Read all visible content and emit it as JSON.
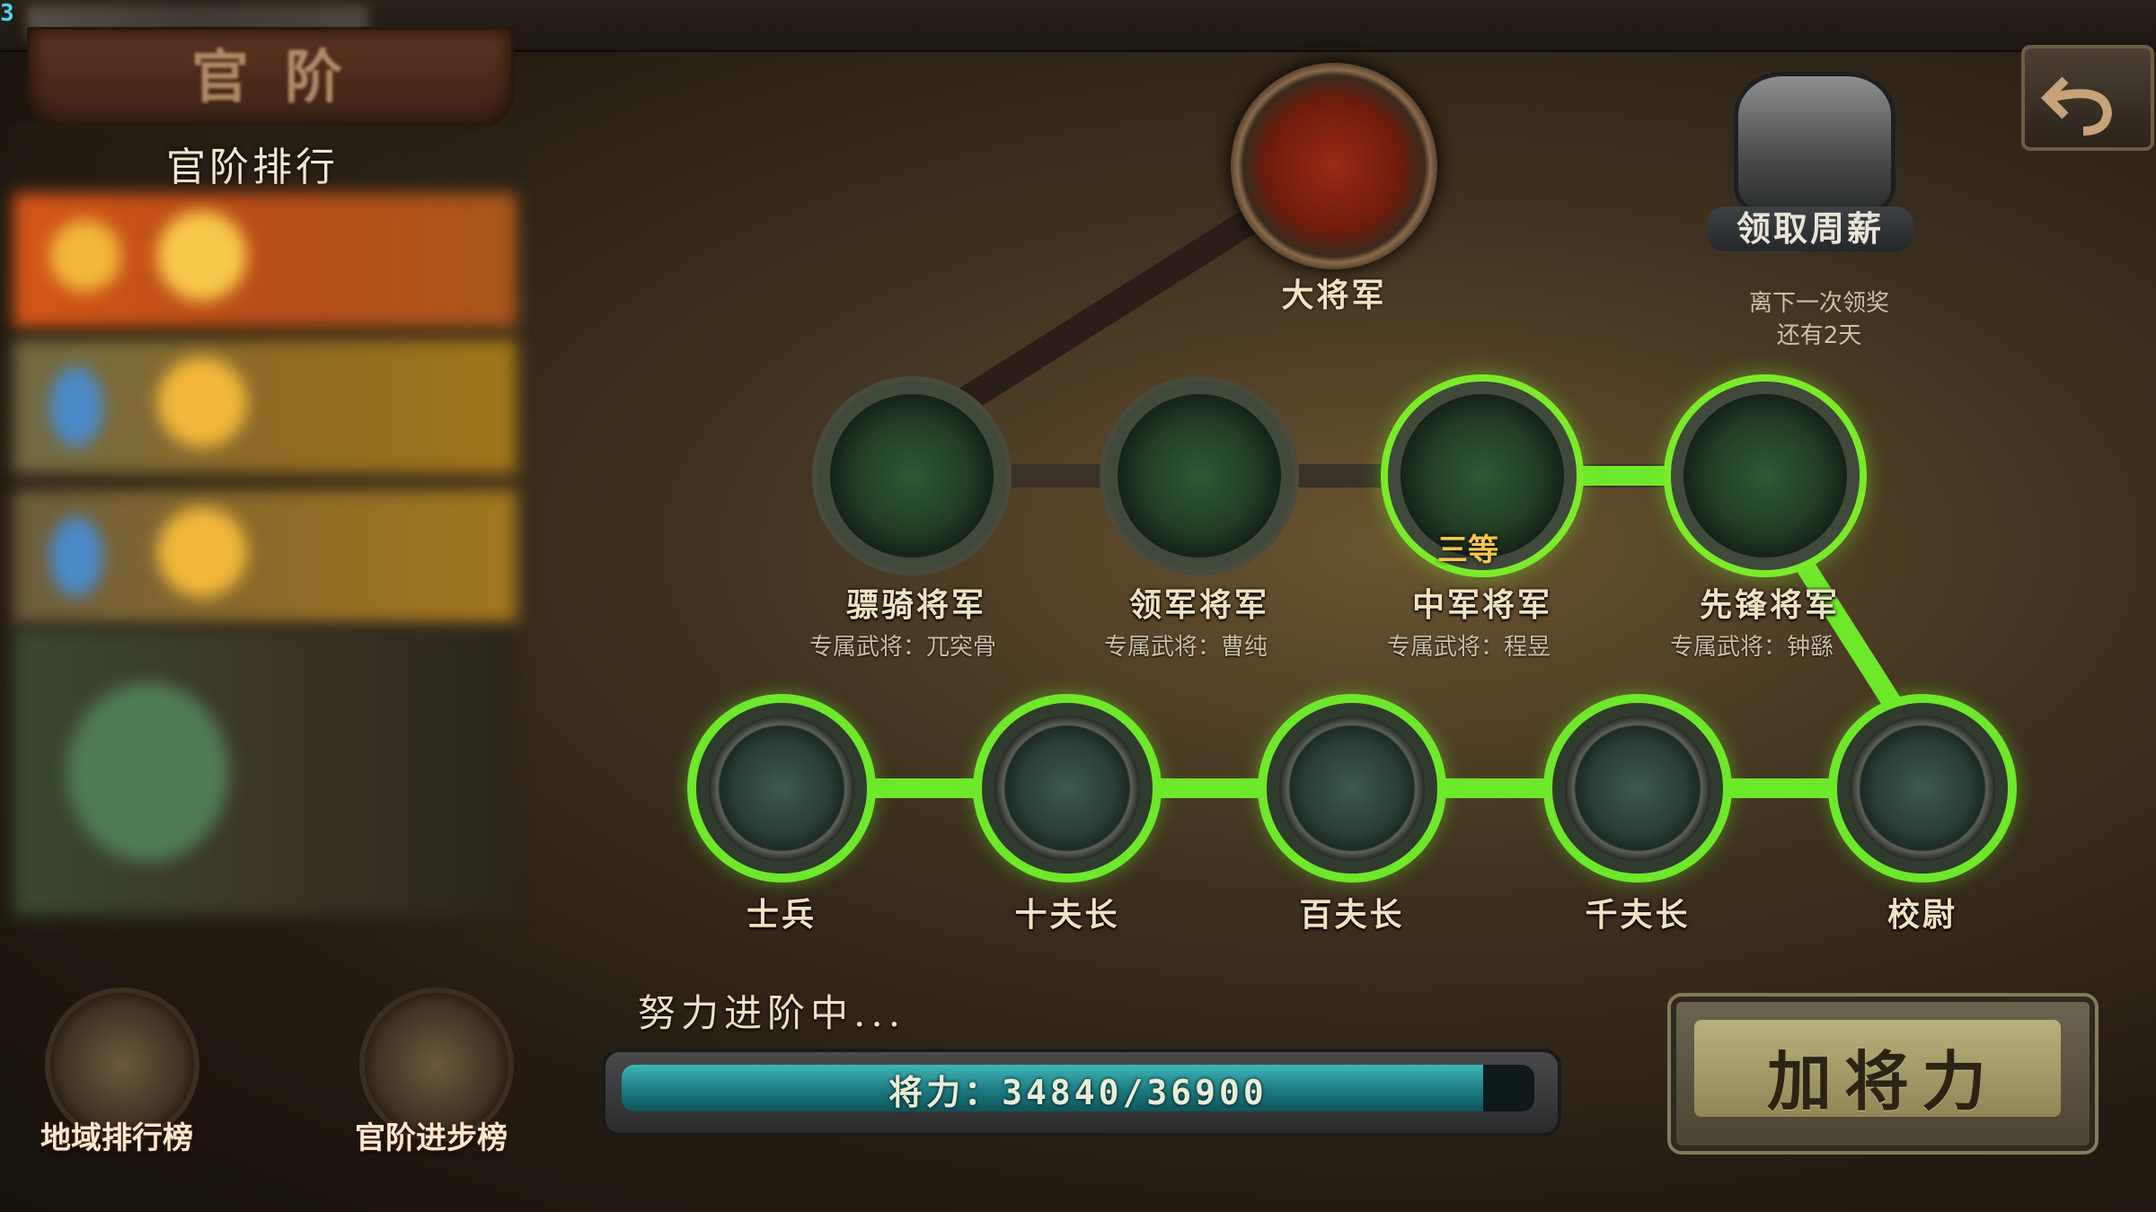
{
  "page": {
    "corner_tag": "3",
    "title_blurred": "官阶"
  },
  "ranking": {
    "header": "官阶排行"
  },
  "top_rank": {
    "label": "大将军"
  },
  "generals_row": [
    {
      "label": "骠骑将军",
      "general": "专属武将：兀突骨",
      "state": "inactive"
    },
    {
      "label": "领军将军",
      "general": "专属武将：曹纯",
      "state": "inactive"
    },
    {
      "label": "中军将军",
      "general": "专属武将：程昱",
      "state": "active",
      "badge": "三等"
    },
    {
      "label": "先锋将军",
      "general": "专属武将：钟繇",
      "state": "active"
    }
  ],
  "soldiers_row": [
    {
      "label": "士兵",
      "icon": "sickle-icon"
    },
    {
      "label": "十夫长",
      "icon": "dagger-icon"
    },
    {
      "label": "百夫长",
      "icon": "axe-icon"
    },
    {
      "label": "千夫长",
      "icon": "saber-icon"
    },
    {
      "label": "校尉",
      "icon": "glaive-icon"
    }
  ],
  "weekly": {
    "button": "领取周薪",
    "note_line1": "离下一次领奖",
    "note_line2": "还有2天"
  },
  "progress": {
    "status": "努力进阶中...",
    "text": "将力：34840/36900",
    "current": 34840,
    "max": 36900
  },
  "bottom_buttons": {
    "region": "地域排行榜",
    "advance": "官阶进步榜"
  },
  "action": {
    "add_power": "加将力"
  },
  "colors": {
    "glow_green": "#6de82a",
    "bar_teal": "#1c7b81"
  }
}
